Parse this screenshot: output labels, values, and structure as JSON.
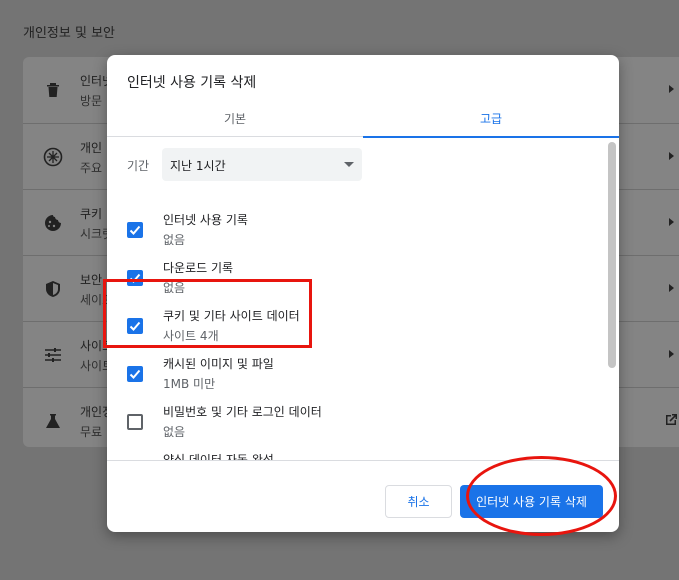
{
  "background": {
    "section_title": "개인정보 및 보안",
    "rows": [
      {
        "icon": "trash-icon",
        "title": "인터넷",
        "subtitle": "방문"
      },
      {
        "icon": "compass-icon",
        "title": "개인",
        "subtitle": "주요"
      },
      {
        "icon": "cookie-icon",
        "title": "쿠키",
        "subtitle": "시크릿"
      },
      {
        "icon": "shield-icon",
        "title": "보안",
        "subtitle": "세이프"
      },
      {
        "icon": "sliders-icon",
        "title": "사이트",
        "subtitle": "사이트"
      },
      {
        "icon": "flask-icon",
        "title": "개인정",
        "subtitle": "무료"
      }
    ]
  },
  "dialog": {
    "title": "인터넷 사용 기록 삭제",
    "tabs": {
      "basic": "기본",
      "advanced": "고급"
    },
    "time_range": {
      "label": "기간",
      "value": "지난 1시간"
    },
    "options": [
      {
        "title": "인터넷 사용 기록",
        "subtitle": "없음",
        "checked": true
      },
      {
        "title": "다운로드 기록",
        "subtitle": "없음",
        "checked": true
      },
      {
        "title": "쿠키 및 기타 사이트 데이터",
        "subtitle": "사이트 4개",
        "checked": true
      },
      {
        "title": "캐시된 이미지 및 파일",
        "subtitle": "1MB 미만",
        "checked": true
      },
      {
        "title": "비밀번호 및 기타 로그인 데이터",
        "subtitle": "없음",
        "checked": false
      },
      {
        "title": "양식 데이터 자동 완성",
        "subtitle": "",
        "checked": false
      }
    ],
    "buttons": {
      "cancel": "취소",
      "delete": "인터넷 사용 기록 삭제"
    }
  },
  "colors": {
    "accent": "#1a73e8",
    "annotation": "#e8150e"
  }
}
